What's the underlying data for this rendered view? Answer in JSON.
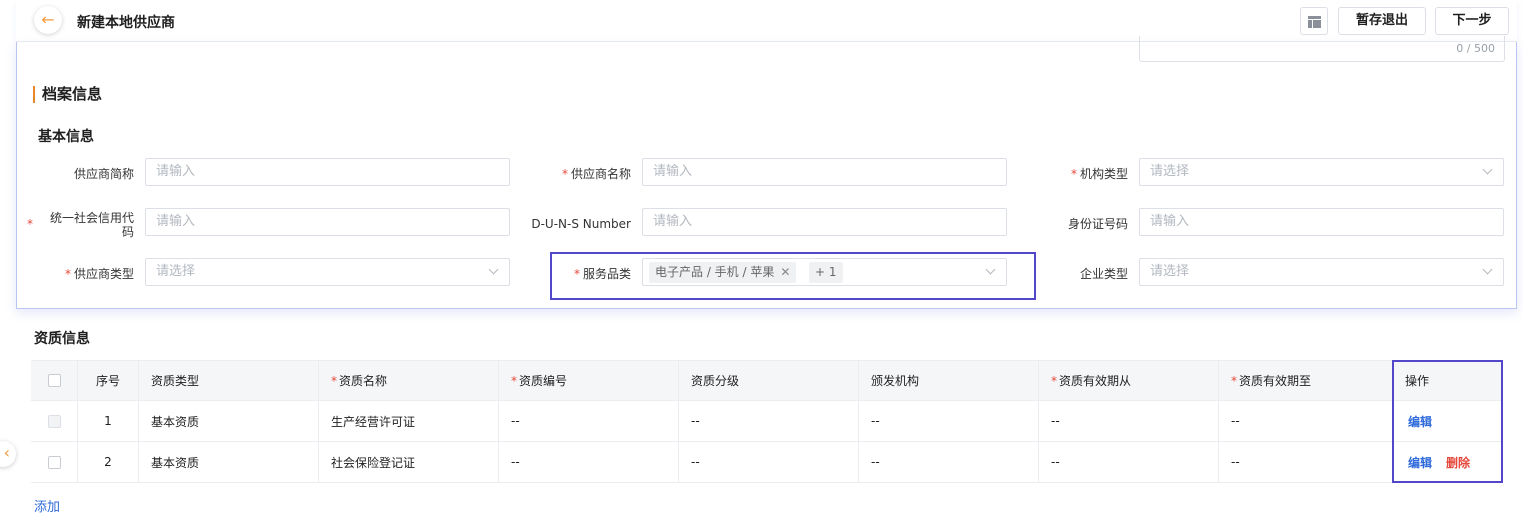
{
  "header": {
    "back_icon": "arrow-left-icon",
    "title": "新建本地供应商",
    "layout_icon": "layout-icon",
    "save_exit_label": "暂存退出",
    "next_label": "下一步"
  },
  "textarea": {
    "counter": "0 / 500"
  },
  "archive": {
    "section_title": "档案信息",
    "basic_title": "基本信息",
    "fields": [
      {
        "label": "供应商简称",
        "required": false,
        "type": "input",
        "placeholder": "请输入"
      },
      {
        "label": "供应商名称",
        "required": true,
        "type": "input",
        "placeholder": "请输入"
      },
      {
        "label": "机构类型",
        "required": true,
        "type": "select",
        "placeholder": "请选择"
      },
      {
        "label": "统一社会信用代码",
        "required": true,
        "type": "input",
        "placeholder": "请输入"
      },
      {
        "label": "D-U-N-S Number",
        "required": false,
        "type": "input",
        "placeholder": "请输入"
      },
      {
        "label": "身份证号码",
        "required": false,
        "type": "input",
        "placeholder": "请输入"
      },
      {
        "label": "供应商类型",
        "required": true,
        "type": "select",
        "placeholder": "请选择"
      },
      {
        "label": "服务品类",
        "required": true,
        "type": "multiselect",
        "tag": "电子产品 / 手机 / 苹果",
        "more": "+ 1"
      },
      {
        "label": "企业类型",
        "required": false,
        "type": "select",
        "placeholder": "请选择"
      }
    ],
    "required_mark": "*"
  },
  "qualification": {
    "title": "资质信息",
    "columns": [
      "序号",
      "资质类型",
      "资质名称",
      "资质编号",
      "资质分级",
      "颁发机构",
      "资质有效期从",
      "资质有效期至",
      "操作"
    ],
    "rows": [
      {
        "index": "1",
        "type": "基本资质",
        "name": "生产经营许可证",
        "number": "--",
        "level": "--",
        "issuer": "--",
        "from": "--",
        "to": "--",
        "edit": "编辑"
      },
      {
        "index": "2",
        "type": "基本资质",
        "name": "社会保险登记证",
        "number": "--",
        "level": "--",
        "issuer": "--",
        "from": "--",
        "to": "--",
        "edit": "编辑",
        "delete": "删除"
      }
    ],
    "add_label": "添加"
  },
  "sidebar_toggle_icon": "chevron-left-icon",
  "colors": {
    "accent": "#e8882a",
    "required": "#e5483c",
    "link": "#2f6bdb",
    "highlight": "#5246c9"
  }
}
